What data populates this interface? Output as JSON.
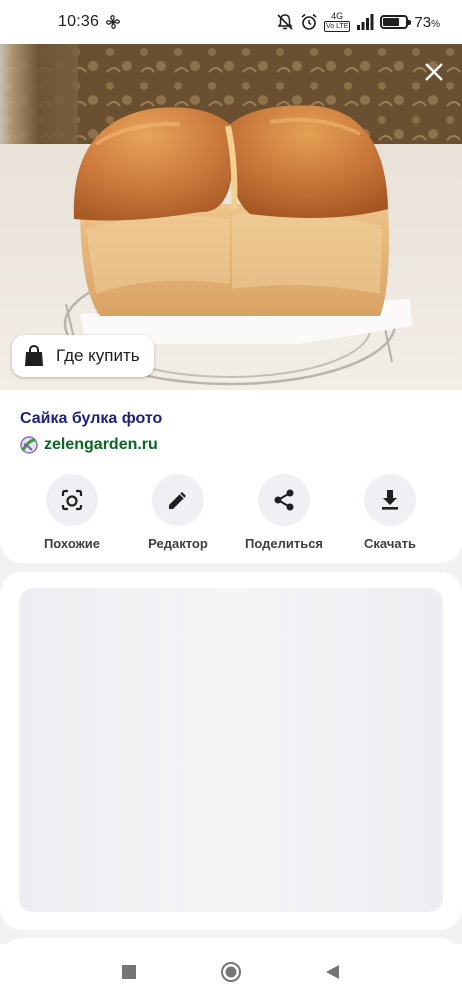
{
  "status_bar": {
    "time": "10:36",
    "network_top": "4G",
    "network_bottom": "Vo LTE",
    "battery_percent": 73,
    "battery_value": "73",
    "battery_unit": "%"
  },
  "photo": {
    "buy_label": "Где купить"
  },
  "result": {
    "title": "Сайка булка фото",
    "source": "zelengarden.ru"
  },
  "actions": [
    {
      "label": "Похожие",
      "icon": "lens-icon"
    },
    {
      "label": "Редактор",
      "icon": "pencil-icon"
    },
    {
      "label": "Поделиться",
      "icon": "share-icon"
    },
    {
      "label": "Скачать",
      "icon": "download-icon"
    }
  ],
  "colors": {
    "title": "#1a237e",
    "source": "#0b6623",
    "action_bg": "#eef0f3"
  }
}
